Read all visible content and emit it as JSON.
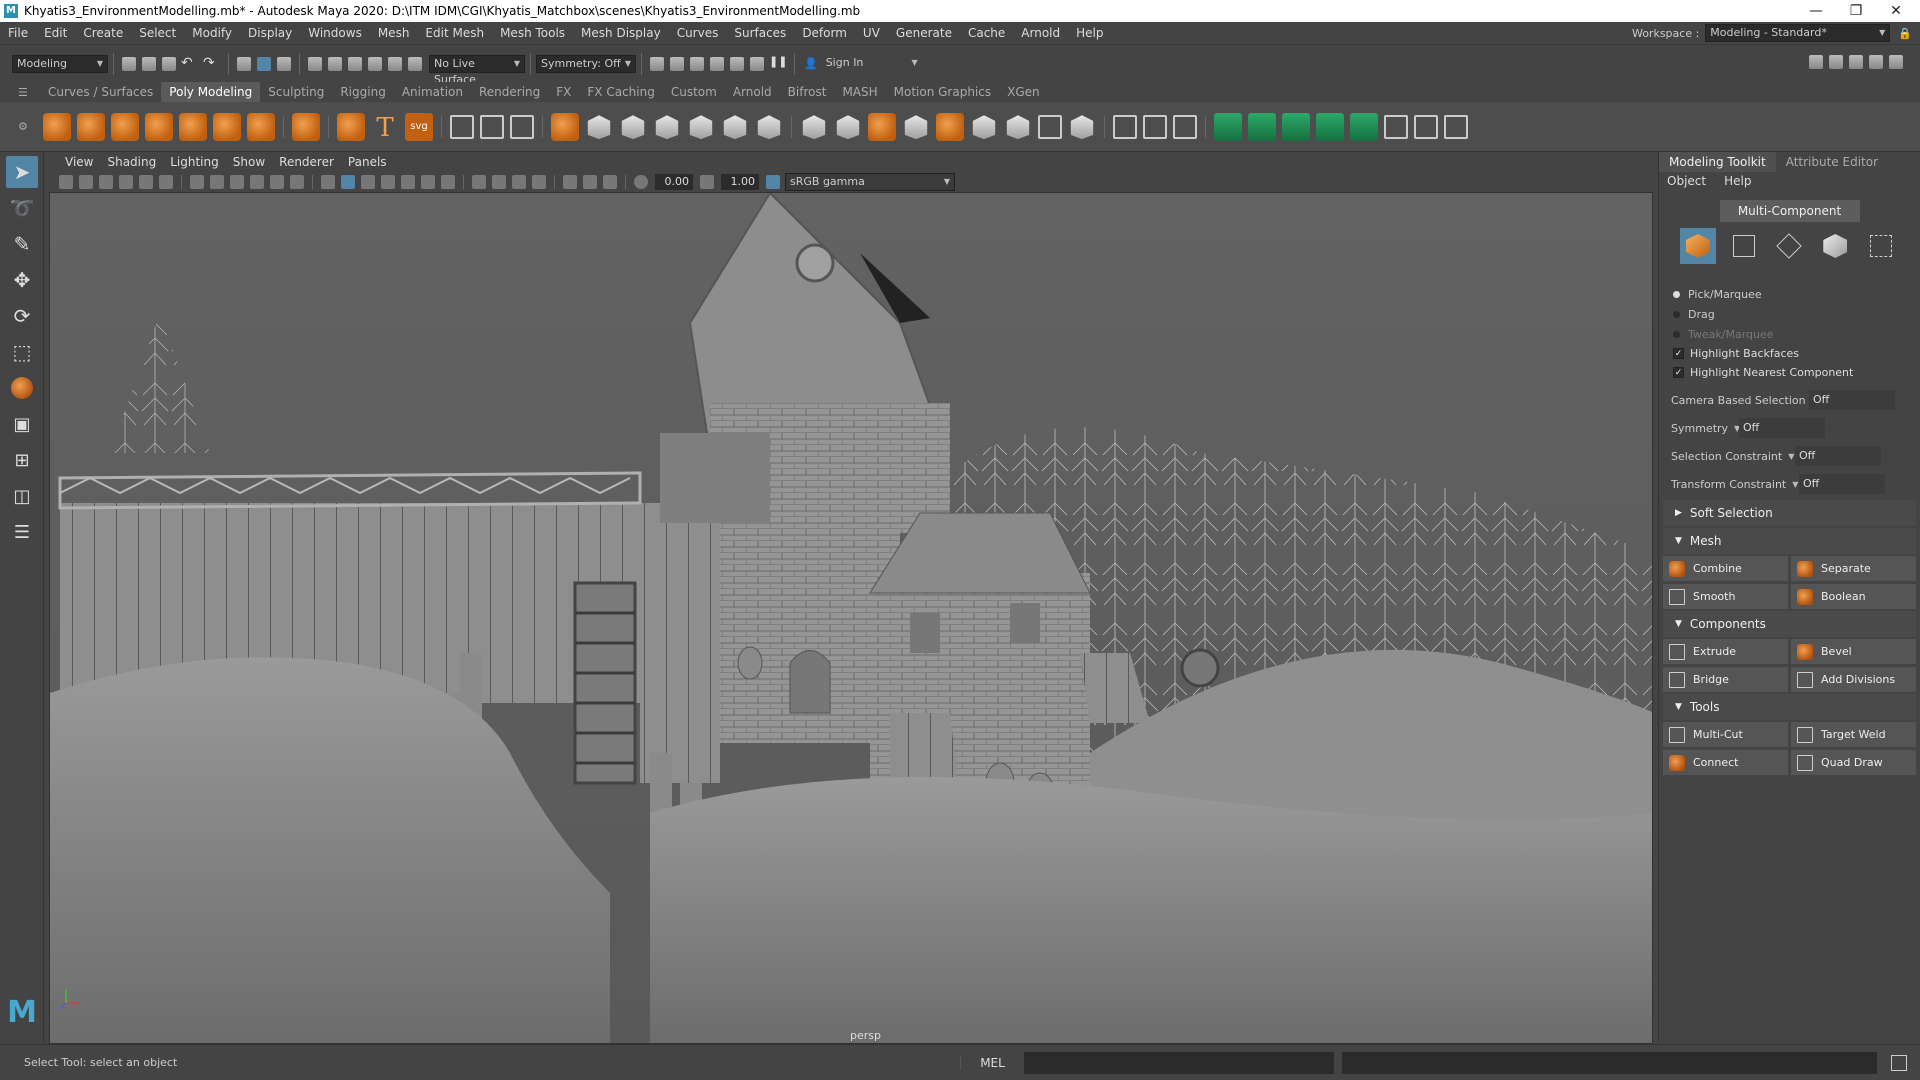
{
  "titlebar": {
    "title": "Khyatis3_EnvironmentModelling.mb* - Autodesk Maya 2020: D:\\ITM IDM\\CGI\\Khyatis_Matchbox\\scenes\\Khyatis3_EnvironmentModelling.mb"
  },
  "menus": [
    "File",
    "Edit",
    "Create",
    "Select",
    "Modify",
    "Display",
    "Windows",
    "Mesh",
    "Edit Mesh",
    "Mesh Tools",
    "Mesh Display",
    "Curves",
    "Surfaces",
    "Deform",
    "UV",
    "Generate",
    "Cache",
    "Arnold",
    "Help"
  ],
  "workspace": {
    "label": "Workspace :",
    "value": "Modeling - Standard*"
  },
  "status": {
    "menuset": "Modeling",
    "live_surface": "No Live Surface",
    "symmetry": "Symmetry: Off",
    "sign_in": "Sign In"
  },
  "shelf_tabs": [
    "Curves / Surfaces",
    "Poly Modeling",
    "Sculpting",
    "Rigging",
    "Animation",
    "Rendering",
    "FX",
    "FX Caching",
    "Custom",
    "Arnold",
    "Bifrost",
    "MASH",
    "Motion Graphics",
    "XGen"
  ],
  "shelf_active": "Poly Modeling",
  "panel_menus": [
    "View",
    "Shading",
    "Lighting",
    "Show",
    "Renderer",
    "Panels"
  ],
  "panel": {
    "near": "0.00",
    "far": "1.00",
    "color_space": "sRGB gamma"
  },
  "viewport": {
    "camera": "persp"
  },
  "toolkit": {
    "tabs": [
      "Modeling Toolkit",
      "Attribute Editor"
    ],
    "menu": [
      "Object",
      "Help"
    ],
    "multi_component": "Multi-Component",
    "selection_modes": [
      "Pick/Marquee",
      "Drag",
      "Tweak/Marquee"
    ],
    "checks": [
      "Highlight Backfaces",
      "Highlight Nearest Component"
    ],
    "options": [
      {
        "label": "Camera Based Selection",
        "value": "Off"
      },
      {
        "label": "Symmetry",
        "value": "Off"
      },
      {
        "label": "Selection Constraint",
        "value": "Off"
      },
      {
        "label": "Transform Constraint",
        "value": "Off"
      }
    ],
    "soft_selection": "Soft Selection",
    "sections": [
      {
        "title": "Mesh",
        "tools": [
          "Combine",
          "Separate",
          "Smooth",
          "Boolean"
        ]
      },
      {
        "title": "Components",
        "tools": [
          "Extrude",
          "Bevel",
          "Bridge",
          "Add Divisions"
        ]
      },
      {
        "title": "Tools",
        "tools": [
          "Multi-Cut",
          "Target Weld",
          "Connect",
          "Quad Draw"
        ]
      }
    ]
  },
  "helpline": {
    "text": "Select Tool: select an object",
    "mel": "MEL"
  },
  "colors": {
    "accent": "#5285a6",
    "shelf_orange": "#e08a30",
    "viewport_bg": "#5f5f5f"
  }
}
